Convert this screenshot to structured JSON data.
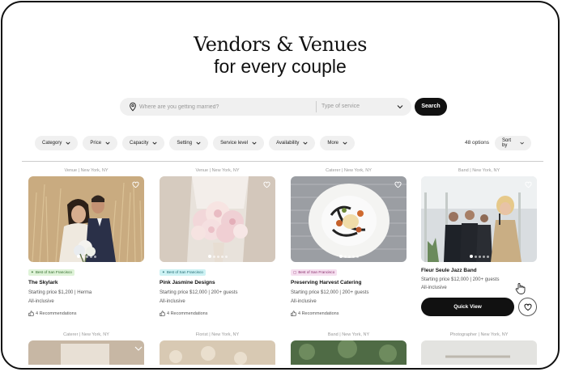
{
  "hero": {
    "line1": "Vendors & Venues",
    "line2": "for every couple"
  },
  "search": {
    "placeholder": "Where are you getting married?",
    "type_placeholder": "Type of service",
    "button": "Search"
  },
  "filters": [
    "Category",
    "Price",
    "Capacity",
    "Setting",
    "Service level",
    "Availability",
    "More"
  ],
  "results": {
    "count": "48 options",
    "sort_label": "Sort by"
  },
  "cards": [
    {
      "category": "Venue | New York, NY",
      "badge": "Best of San Francisco",
      "badge_color": "#dff3d8",
      "name": "The Skylark",
      "price": "Starting price $1,200 | Herma",
      "inclusion": "All-inclusive",
      "recs": "4 Recommendations"
    },
    {
      "category": "Venue | New York, NY",
      "badge": "Best of San Francisco",
      "badge_color": "#cdf2f4",
      "name": "Pink Jasmine Designs",
      "price": "Starting price $12,000 | 200+ guests",
      "inclusion": "All-inclusive",
      "recs": "4 Recommendations"
    },
    {
      "category": "Caterer | New York, NY",
      "badge": "Best of San Francisco",
      "badge_color": "#f6e0f0",
      "name": "Preserving Harvest Catering",
      "price": "Starting price $12,000 | 200+ guests",
      "inclusion": "All-inclusive",
      "recs": "4 Recommendations"
    },
    {
      "category": "Band | New York, NY",
      "name": "Fleur Seule Jazz Band",
      "price": "Starting price $12,000 | 200+ guests",
      "inclusion": "All-inclusive"
    }
  ],
  "quick_view": "Quick View",
  "row2": [
    "Caterer | New York, NY",
    "Florist | New York, NY",
    "Band | New York, NY",
    "Photographer | New York, NY"
  ]
}
